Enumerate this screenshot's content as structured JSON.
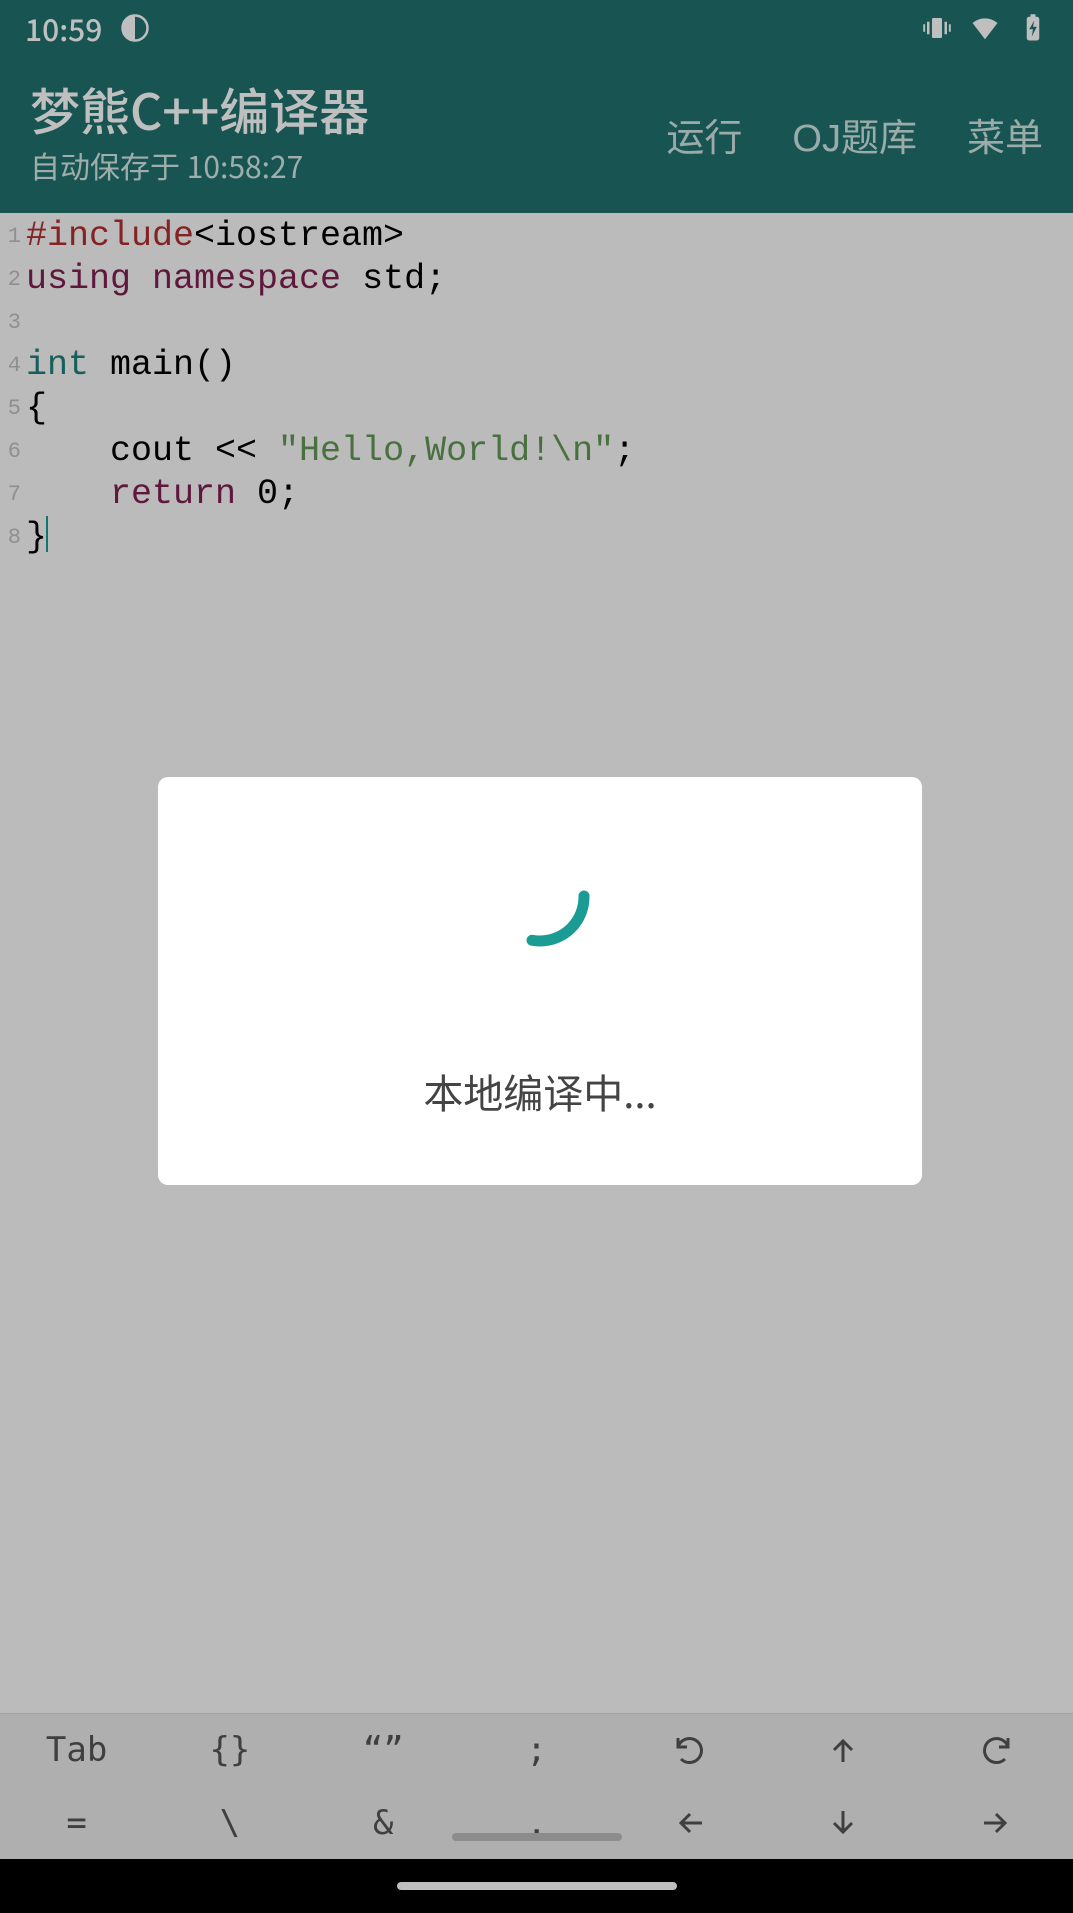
{
  "status": {
    "time": "10:59"
  },
  "header": {
    "title": "梦熊C++编译器",
    "subtitle": "自动保存于 10:58:27",
    "actions": {
      "run": "运行",
      "oj": "OJ题库",
      "menu": "菜单"
    }
  },
  "code": {
    "lines": [
      {
        "n": "1",
        "tokens": [
          [
            "kw-pre",
            "#include"
          ],
          [
            "",
            "<iostream>"
          ]
        ]
      },
      {
        "n": "2",
        "tokens": [
          [
            "kw-key",
            "using namespace"
          ],
          [
            "",
            " std;"
          ]
        ]
      },
      {
        "n": "3",
        "tokens": [
          [
            "",
            ""
          ]
        ]
      },
      {
        "n": "4",
        "tokens": [
          [
            "kw-type",
            "int"
          ],
          [
            "",
            " main()"
          ]
        ]
      },
      {
        "n": "5",
        "tokens": [
          [
            "",
            "{"
          ]
        ]
      },
      {
        "n": "6",
        "tokens": [
          [
            "",
            "    cout << "
          ],
          [
            "str",
            "\"Hello,World!\\n\""
          ],
          [
            "",
            ";"
          ]
        ]
      },
      {
        "n": "7",
        "tokens": [
          [
            "kw-key",
            "    return"
          ],
          [
            "",
            " 0;"
          ]
        ]
      },
      {
        "n": "8",
        "tokens": [
          [
            "",
            "}"
          ]
        ],
        "cursor": true
      }
    ]
  },
  "dialog": {
    "text": "本地编译中..."
  },
  "toolbar": {
    "row1": [
      "Tab",
      "{}",
      "“”",
      ";",
      "undo-icon",
      "arrow-up-icon",
      "redo-icon"
    ],
    "row2": [
      "=",
      "\\",
      "&",
      ",",
      "arrow-left-icon",
      "arrow-down-icon",
      "arrow-right-icon"
    ]
  }
}
